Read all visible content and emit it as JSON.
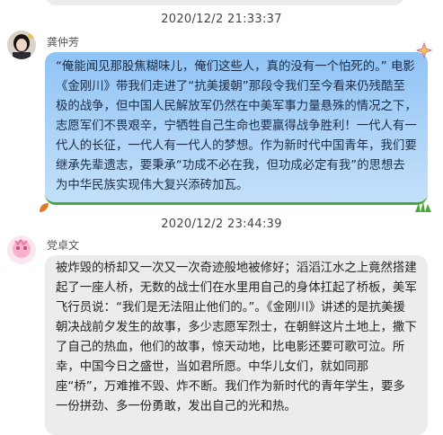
{
  "messages": [
    {
      "timestamp": "2020/12/2 21:33:37",
      "sender": "龚仲芳",
      "text": "“俺能闻见那股焦糊味儿，俺们这些人，真的没有一个怕死的。” 电影《金刚川》带我们走进了“抗美援朝”那段令我们至今看来仍残酷至极的战争，但中国人民解放军仍然在中美军事力量悬殊的情况之下，志愿军们不畏艰辛，宁牺牲自己生命也要赢得战争胜利！一代人有一代人的长征，一代人有一代人的梦想。作为新时代中国青年，我们要继承先辈遗志，要秉承“功成不必在我，但功成必定有我”的思想去为中华民族实现伟大复兴添砖加瓦。"
    },
    {
      "timestamp": "2020/12/2 23:44:39",
      "sender": "党卓文",
      "text": "被炸毁的桥却又一次又一次奇迹般地被修好；滔滔江水之上竟然搭建起了一座人桥，无数的战士们在水里用自己的身体扛起了桥板，美军飞行员说：“我们是无法阻止他们的。”。《金刚川》讲述的是抗美援朝决战前夕发生的故事，多少志愿军烈士，在朝鲜这片土地上，撒下了自己的热血，他们的故事，惊天动地，比电影还要可歌可泣。所幸，中国今日之盛世，当如君所愿。中华儿女们，就如同那座“桥”，万难推不毁、炸不断。我们作为新时代的青年学生，要多一份拼劲、多一份勇敢，发出自己的光和热。"
    }
  ]
}
